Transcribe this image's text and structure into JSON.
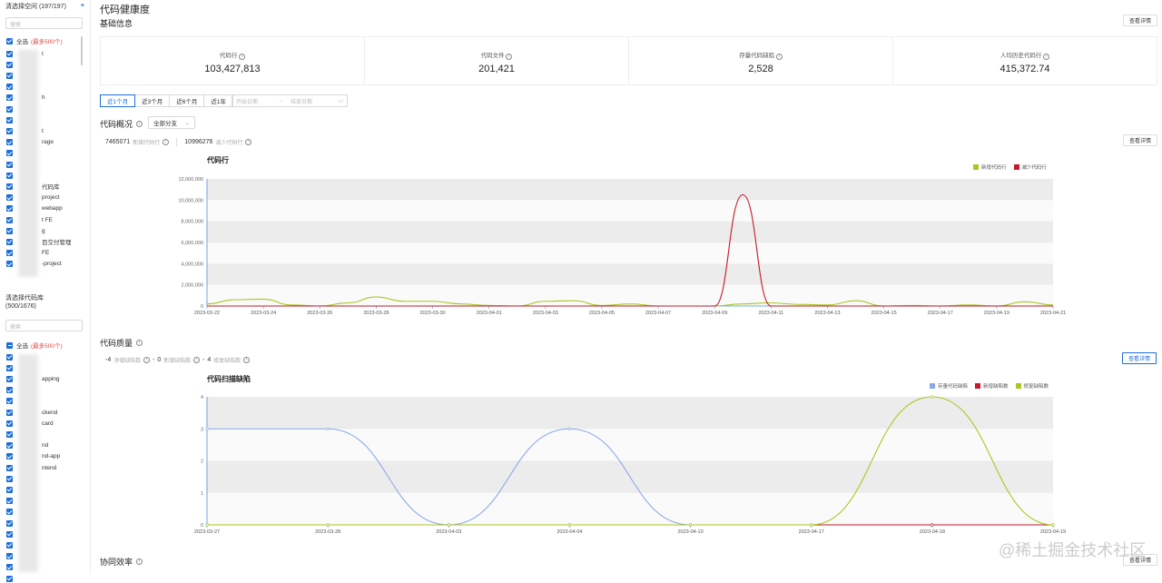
{
  "sidebar": {
    "space_header": "清选择空间 (197/197)",
    "space_search_placeholder": "搜索",
    "space_select_all": "全选",
    "space_select_all_note": "(最多500个)",
    "space_items": [
      "t",
      "",
      "",
      "",
      "h",
      "",
      "",
      "t",
      "rage",
      "",
      "",
      "",
      "代码库",
      "project",
      "webapp",
      "t FE",
      "g",
      "目交付管理",
      "FE",
      "-project"
    ],
    "repo_header": "清选择代码库",
    "repo_count": "(500/1676)",
    "repo_search_placeholder": "搜索",
    "repo_select_all": "全选",
    "repo_select_all_note": "(最多500个)",
    "repo_items": [
      "",
      "",
      "apping",
      "",
      "",
      "ckend",
      "card",
      "",
      "nd",
      "nd-app",
      "ntend",
      "",
      "",
      "",
      "",
      "",
      "",
      "",
      "",
      "",
      ""
    ]
  },
  "main": {
    "page_title": "代码健康度",
    "basic_info": "基础信息",
    "view_detail": "查看详情",
    "cards": [
      {
        "label": "代码行",
        "value": "103,427,813"
      },
      {
        "label": "代码文件",
        "value": "201,421"
      },
      {
        "label": "存量代码缺陷",
        "value": "2,528"
      },
      {
        "label": "人均历史代码行",
        "value": "415,372.74"
      }
    ],
    "tabs": [
      "近1个月",
      "近3个月",
      "近6个月",
      "近1年"
    ],
    "date_start_placeholder": "开始日期",
    "date_arrow": "→",
    "date_end_placeholder": "结束日期",
    "overview_title": "代码概况",
    "branch_select": "全部分支",
    "overview_stats": {
      "added": "7465071",
      "added_label": "新增代码行",
      "removed": "10996276",
      "removed_label": "减少代码行"
    },
    "quality_title": "代码质量",
    "quality_stats": {
      "a": "-4",
      "a_label": "净增缺陷数",
      "b": "0",
      "b_label": "新增缺陷数",
      "c": "4",
      "c_label": "修复缺陷数"
    },
    "collab_title": "协同效率",
    "watermark": "@稀土掘金技术社区",
    "colors": {
      "accent": "#1e6fd9",
      "green": "#a8c820",
      "red": "#c8182a",
      "blue": "#8aa8e8"
    }
  },
  "chart_data": [
    {
      "type": "line",
      "title": "代码行",
      "x": [
        "2023-03-22",
        "2023-03-23",
        "2023-03-24",
        "2023-03-25",
        "2023-03-26",
        "2023-03-27",
        "2023-03-28",
        "2023-03-29",
        "2023-03-30",
        "2023-03-31",
        "2023-04-01",
        "2023-04-02",
        "2023-04-03",
        "2023-04-04",
        "2023-04-05",
        "2023-04-06",
        "2023-04-07",
        "2023-04-08",
        "2023-04-09",
        "2023-04-10",
        "2023-04-11",
        "2023-04-12",
        "2023-04-13",
        "2023-04-14",
        "2023-04-15",
        "2023-04-16",
        "2023-04-17",
        "2023-04-18",
        "2023-04-19",
        "2023-04-20",
        "2023-04-21"
      ],
      "x_ticks": [
        "2023-03-22",
        "2023-03-24",
        "2023-03-26",
        "2023-03-28",
        "2023-03-30",
        "2023-04-01",
        "2023-04-03",
        "2023-04-05",
        "2023-04-07",
        "2023-04-09",
        "2023-04-11",
        "2023-04-13",
        "2023-04-15",
        "2023-04-17",
        "2023-04-19",
        "2023-04-21"
      ],
      "y_ticks": [
        "0",
        "2,000,000",
        "4,000,000",
        "6,000,000",
        "8,000,000",
        "10,000,000",
        "12,000,000"
      ],
      "ylim": [
        0,
        12000000
      ],
      "series": [
        {
          "name": "新增代码行",
          "color": "#a8c820",
          "values": [
            200000,
            600000,
            650000,
            100000,
            0,
            300000,
            850000,
            450000,
            450000,
            200000,
            50000,
            0,
            450000,
            500000,
            50000,
            200000,
            0,
            0,
            0,
            200000,
            300000,
            150000,
            100000,
            500000,
            0,
            50000,
            0,
            100000,
            0,
            400000,
            100000
          ]
        },
        {
          "name": "减少代码行",
          "color": "#c8182a",
          "values": [
            0,
            0,
            0,
            0,
            0,
            0,
            0,
            0,
            0,
            0,
            0,
            0,
            0,
            0,
            0,
            0,
            0,
            0,
            0,
            10500000,
            0,
            0,
            0,
            0,
            0,
            0,
            0,
            0,
            0,
            0,
            0
          ]
        }
      ]
    },
    {
      "type": "line",
      "title": "代码扫描缺陷",
      "x": [
        "2023-03-27",
        "2023-03-28",
        "2023-04-03",
        "2023-04-04",
        "2023-04-10",
        "2023-04-17",
        "2023-04-18",
        "2023-04-19"
      ],
      "y_ticks": [
        "0",
        "1",
        "2",
        "3",
        "4"
      ],
      "ylim": [
        0,
        4
      ],
      "series": [
        {
          "name": "存量代码缺陷",
          "color": "#8aa8e8",
          "values": [
            3,
            3,
            0,
            3,
            0,
            0,
            0,
            0
          ]
        },
        {
          "name": "新增缺陷数",
          "color": "#c8182a",
          "values": [
            0,
            0,
            0,
            0,
            0,
            0,
            0,
            0
          ]
        },
        {
          "name": "修复缺陷数",
          "color": "#a8c820",
          "values": [
            0,
            0,
            0,
            0,
            0,
            0,
            4,
            0
          ]
        }
      ]
    }
  ]
}
